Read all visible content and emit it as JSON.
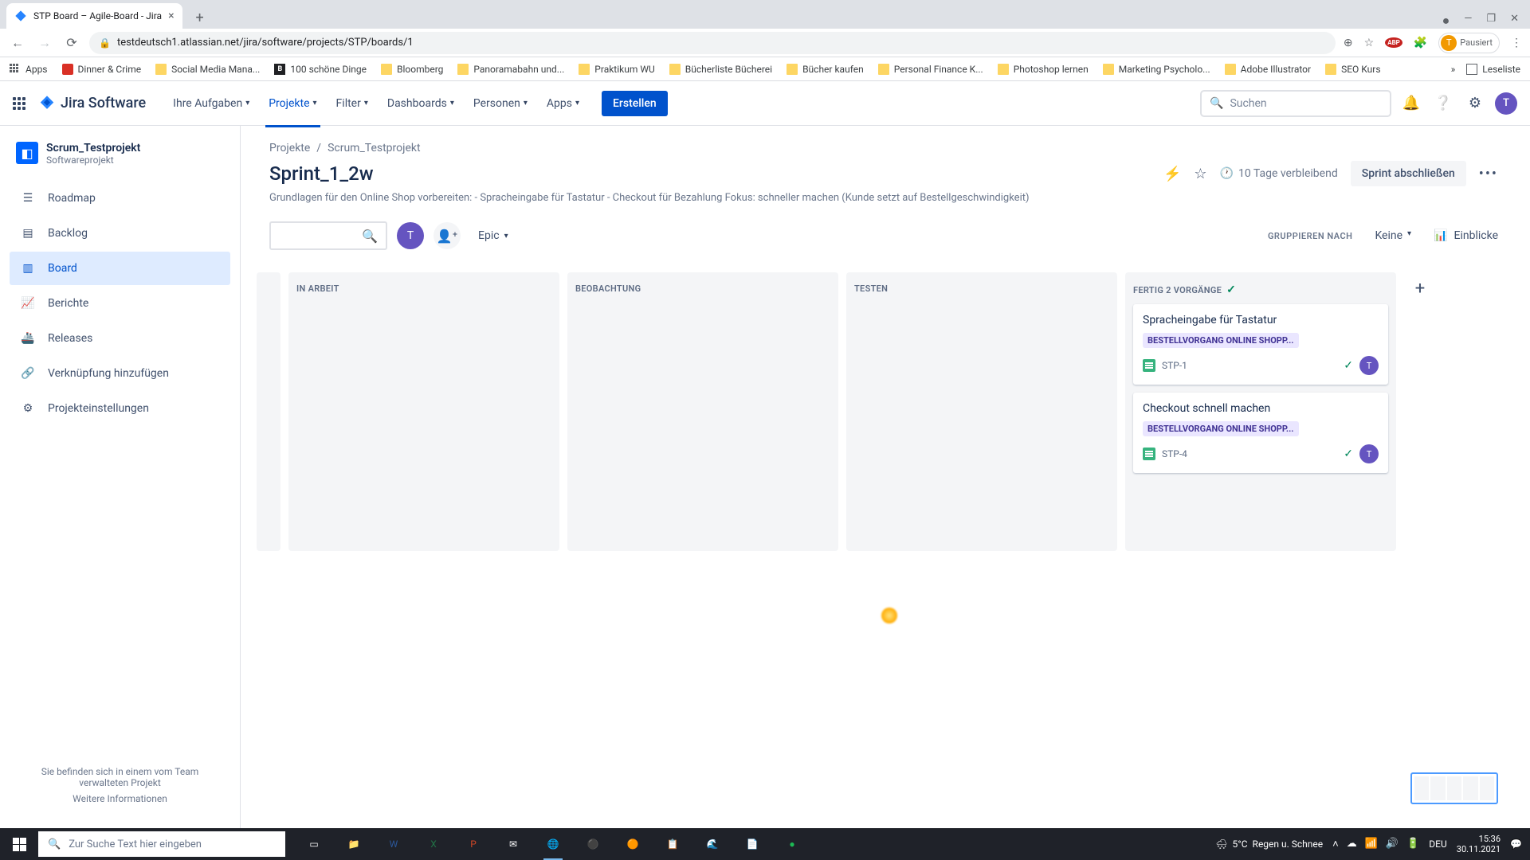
{
  "browser": {
    "tab_title": "STP Board – Agile-Board - Jira",
    "url": "testdeutsch1.atlassian.net/jira/software/projects/STP/boards/1",
    "profile_label": "Pausiert",
    "bookmarks": [
      "Apps",
      "Dinner & Crime",
      "Social Media Mana...",
      "100 schöne Dinge",
      "Bloomberg",
      "Panoramabahn und...",
      "Praktikum WU",
      "Bücherliste Bücherei",
      "Bücher kaufen",
      "Personal Finance K...",
      "Photoshop lernen",
      "Marketing Psycholo...",
      "Adobe Illustrator",
      "SEO Kurs"
    ],
    "bookmarks_right": "Leseliste"
  },
  "jira": {
    "logo": "Jira Software",
    "nav": [
      "Ihre Aufgaben",
      "Projekte",
      "Filter",
      "Dashboards",
      "Personen",
      "Apps"
    ],
    "create": "Erstellen",
    "search_placeholder": "Suchen"
  },
  "project": {
    "name": "Scrum_Testprojekt",
    "type": "Softwareprojekt"
  },
  "sidebar": {
    "items": [
      "Roadmap",
      "Backlog",
      "Board",
      "Berichte",
      "Releases",
      "Verknüpfung hinzufügen",
      "Projekteinstellungen"
    ],
    "footer1": "Sie befinden sich in einem vom Team verwalteten Projekt",
    "footer2": "Weitere Informationen"
  },
  "breadcrumb": {
    "root": "Projekte",
    "proj": "Scrum_Testprojekt"
  },
  "sprint": {
    "title": "Sprint_1_2w",
    "desc": "Grundlagen für den Online Shop vorbereiten: - Spracheingabe für Tastatur - Checkout für Bezahlung Fokus: schneller machen (Kunde setzt auf Bestellgeschwindigkeit)",
    "days_left": "10 Tage verbleibend",
    "complete": "Sprint abschließen"
  },
  "filters": {
    "epic": "Epic",
    "group_label": "GRUPPIEREN NACH",
    "group_value": "Keine",
    "insights": "Einblicke"
  },
  "columns": {
    "c1": "IN ARBEIT",
    "c2": "BEOBACHTUNG",
    "c3": "TESTEN",
    "c4": "FERTIG 2 VORGÄNGE"
  },
  "cards": [
    {
      "title": "Spracheingabe für Tastatur",
      "epic": "BESTELLVORGANG ONLINE SHOPP...",
      "key": "STP-1",
      "assignee": "T"
    },
    {
      "title": "Checkout schnell machen",
      "epic": "BESTELLVORGANG ONLINE SHOPP...",
      "key": "STP-4",
      "assignee": "T"
    }
  ],
  "taskbar": {
    "search": "Zur Suche Text hier eingeben",
    "weather_temp": "5°C",
    "weather_desc": "Regen u. Schnee",
    "lang": "DEU",
    "time": "15:36",
    "date": "30.11.2021"
  }
}
